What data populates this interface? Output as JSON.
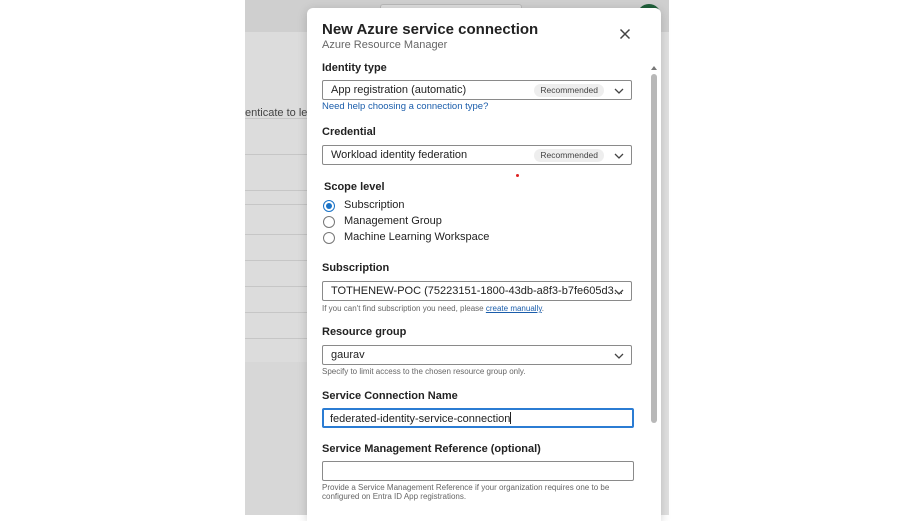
{
  "background": {
    "partial_text": "enticate to lev"
  },
  "modal": {
    "title": "New Azure service connection",
    "subtitle": "Azure Resource Manager",
    "close_icon": "close-icon"
  },
  "identity_type": {
    "label": "Identity type",
    "value": "App registration (automatic)",
    "badge": "Recommended",
    "help_link": "Need help choosing a connection type?"
  },
  "credential": {
    "label": "Credential",
    "value": "Workload identity federation",
    "badge": "Recommended"
  },
  "scope_level": {
    "label": "Scope level",
    "options": [
      {
        "label": "Subscription",
        "selected": true
      },
      {
        "label": "Management Group",
        "selected": false
      },
      {
        "label": "Machine Learning Workspace",
        "selected": false
      }
    ]
  },
  "subscription": {
    "label": "Subscription",
    "value": "TOTHENEW-POC (75223151-1800-43db-a8f3-b7fe605d3...",
    "hint_prefix": "If you can't find subscription you need, please ",
    "hint_link": "create manually",
    "hint_suffix": "."
  },
  "resource_group": {
    "label": "Resource group",
    "value": "gaurav",
    "hint": "Specify to limit access to the chosen resource group only."
  },
  "service_connection_name": {
    "label": "Service Connection Name",
    "value": "federated-identity-service-connection"
  },
  "service_management_reference": {
    "label": "Service Management Reference (optional)",
    "value": "",
    "hint_line1": "Provide a Service Management Reference if your organization requires one to be",
    "hint_line2": "configured on Entra ID App registrations."
  },
  "colors": {
    "accent": "#1a73c7",
    "focus_border": "#2b7cd3",
    "link": "#1a5dab",
    "redaction": "#e01f1f"
  }
}
